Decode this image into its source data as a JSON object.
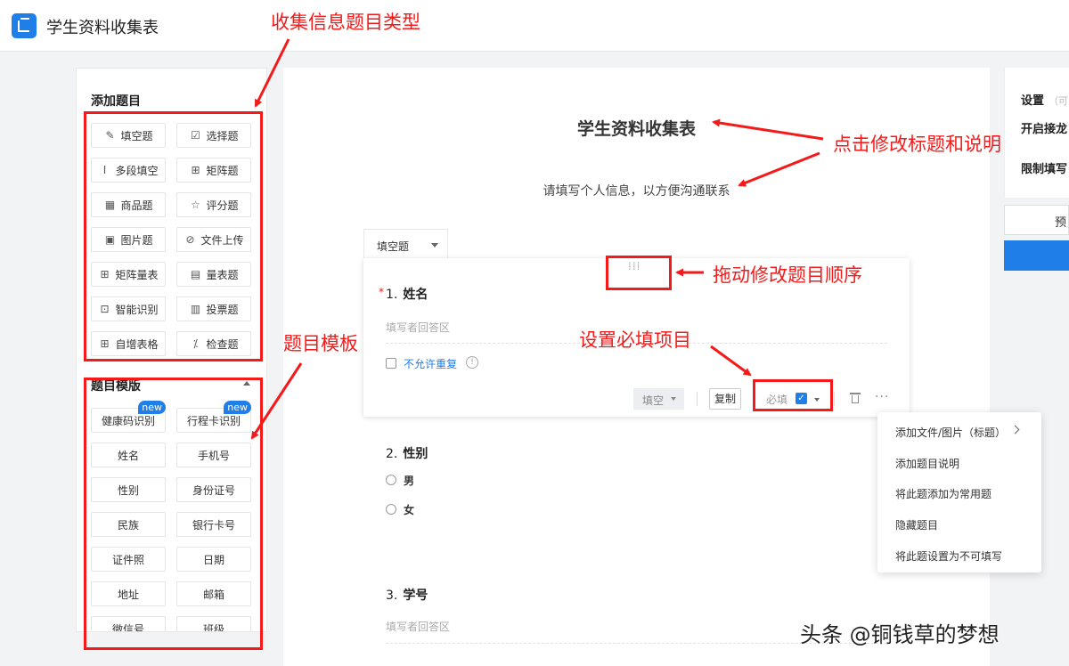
{
  "app": {
    "title": "学生资料收集表"
  },
  "left": {
    "add_title": "添加题目",
    "question_types": [
      {
        "label": "填空题",
        "icon": "✎"
      },
      {
        "label": "选择题",
        "icon": "☑"
      },
      {
        "label": "多段填空",
        "icon": "Ⅰ"
      },
      {
        "label": "矩阵题",
        "icon": "⊞"
      },
      {
        "label": "商品题",
        "icon": "▦"
      },
      {
        "label": "评分题",
        "icon": "☆"
      },
      {
        "label": "图片题",
        "icon": "▣"
      },
      {
        "label": "文件上传",
        "icon": "⊘"
      },
      {
        "label": "矩阵量表",
        "icon": "⊞"
      },
      {
        "label": "量表题",
        "icon": "▤"
      },
      {
        "label": "智能识别",
        "icon": "⊡"
      },
      {
        "label": "投票题",
        "icon": "▥"
      },
      {
        "label": "自增表格",
        "icon": "⊞"
      },
      {
        "label": "检查题",
        "icon": "⁒"
      }
    ],
    "template_title": "题目模版",
    "new_badge": "new",
    "templates": [
      "健康码识别",
      "行程卡识别",
      "姓名",
      "手机号",
      "性别",
      "身份证号",
      "民族",
      "银行卡号",
      "证件照",
      "日期",
      "地址",
      "邮箱",
      "微信号",
      "班级"
    ]
  },
  "form": {
    "title": "学生资料收集表",
    "description": "请填写个人信息，以方便沟通联系",
    "type_tab": "填空题",
    "q1": {
      "required_mark": "*",
      "number": "1.",
      "title": "姓名",
      "placeholder": "填写者回答区",
      "no_duplicate": "不允许重复",
      "info": "!",
      "type_select": "填空",
      "copy": "复制",
      "required": "必填",
      "check": "✓",
      "drag": "⁞⁞⁞",
      "more": "···"
    },
    "q2": {
      "number": "2.",
      "title": "性别",
      "options": [
        "男",
        "女"
      ]
    },
    "q3": {
      "number": "3.",
      "title": "学号",
      "placeholder": "填写者回答区"
    }
  },
  "settings": {
    "title": "设置",
    "hint": "（可",
    "row1": "开启接龙",
    "row2": "限制填写",
    "preview": "预"
  },
  "context_menu": [
    "添加文件/图片（标题）",
    "添加题目说明",
    "将此题添加为常用题",
    "隐藏题目",
    "将此题设置为不可填写"
  ],
  "annotations": {
    "types": "收集信息题目类型",
    "title_edit": "点击修改标题和说明",
    "drag": "拖动修改题目顺序",
    "required": "设置必填项目",
    "template": "题目模板"
  },
  "watermark": "头条 @铜钱草的梦想",
  "colors": {
    "annotation_red": "#f51a1a",
    "brand_blue": "#1f7ee8"
  }
}
